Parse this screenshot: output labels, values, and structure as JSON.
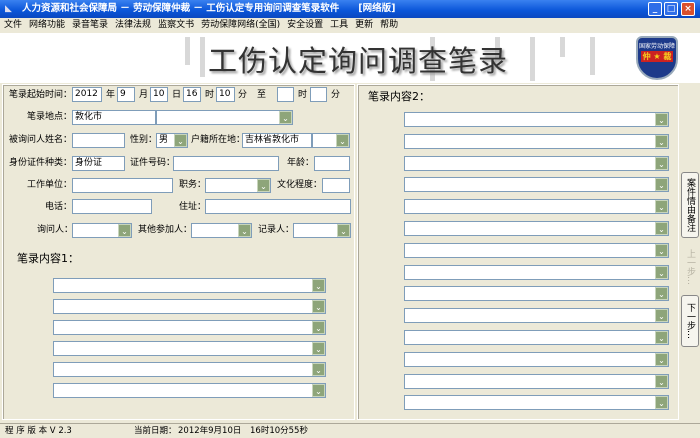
{
  "window": {
    "title": "人力资源和社会保障局 － 劳动保障仲裁 － 工伤认定专用询问调查笔录软件　　[网络版]",
    "minimize": "_",
    "maximize": "□",
    "close": "×"
  },
  "menu": [
    "文件",
    "网络功能",
    "录音笔录",
    "法律法规",
    "监察文书",
    "劳动保障网络(全国)",
    "安全设置",
    "工具",
    "更新",
    "帮助"
  ],
  "banner": {
    "title": "工伤认定询问调查笔录",
    "logo_text": "国家劳动保障",
    "logo_main": "仲 ★ 裁"
  },
  "form": {
    "start_time_label": "笔录起始时间：",
    "year": "2012",
    "year_unit": "年",
    "month": "9",
    "month_unit": "月",
    "day": "10",
    "day_unit": "日",
    "hour": "16",
    "hour_unit": "时",
    "minute": "10",
    "minute_unit": "分",
    "to": "至",
    "end_hour": "",
    "end_hour_unit": "时",
    "end_minute": "",
    "end_minute_unit": "分",
    "location_label": "笔录地点：",
    "location": "敦化市",
    "location_combo": "",
    "name_label": "被询问人姓名：",
    "name": "",
    "gender_label": "性别：",
    "gender": "男",
    "domicile_label": "户籍所在地：",
    "domicile": "吉林省敦化市",
    "domicile_combo": "",
    "id_type_label": "身份证件种类：",
    "id_type": "身份证",
    "id_number_label": "证件号码：",
    "id_number": "",
    "age_label": "年龄：",
    "age": "",
    "employer_label": "工作单位：",
    "employer": "",
    "position_label": "职务：",
    "position": "",
    "education_label": "文化程度：",
    "education": "",
    "phone_label": "电话：",
    "phone": "",
    "address_label": "住址：",
    "address": "",
    "interviewer_label": "询问人：",
    "interviewer": "",
    "participants_label": "其他参加人：",
    "participants": "",
    "recorder_label": "记录人：",
    "recorder": "",
    "content1_label": "笔录内容1：",
    "content2_label": "笔录内容2："
  },
  "side_buttons": {
    "notes": "案件情由备注",
    "prev": "上一步…",
    "next": "下一步…"
  },
  "status": {
    "version": "程 序 版 本 V 2.3",
    "date_label": "当前日期：",
    "date": "2012年9月10日",
    "time": "16时10分55秒"
  }
}
